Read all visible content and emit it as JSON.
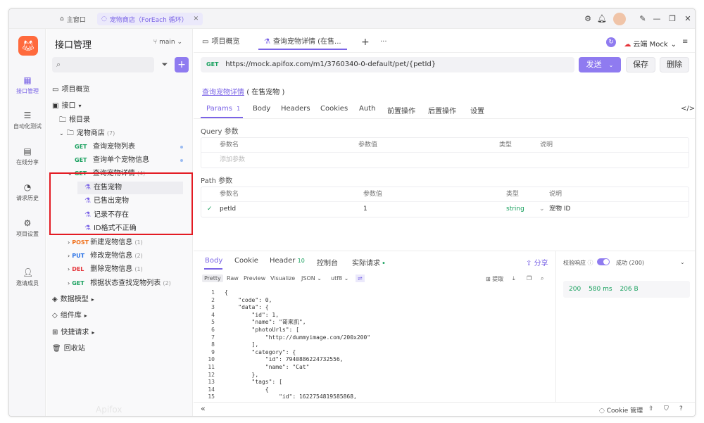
{
  "titlebar": {
    "home_label": "主窗口",
    "project_tab": "宠物商店（ForEach 循环）"
  },
  "rail": {
    "items": [
      {
        "label": "接口管理"
      },
      {
        "label": "自动化测试"
      },
      {
        "label": "在线分享"
      },
      {
        "label": "请求历史"
      },
      {
        "label": "项目设置"
      },
      {
        "label": "邀请成员"
      }
    ]
  },
  "sidebar": {
    "title": "接口管理",
    "branch": "main",
    "tree": [
      {
        "label": "项目概览"
      },
      {
        "label": "接口"
      },
      {
        "label": "根目录"
      },
      {
        "label": "宠物商店",
        "count": "(7)"
      },
      {
        "method": "GET",
        "label": "查询宠物列表"
      },
      {
        "method": "GET",
        "label": "查询单个宠物信息"
      },
      {
        "method": "GET",
        "label": "查询宠物详情",
        "count": "(4)"
      },
      {
        "label": "在售宠物"
      },
      {
        "label": "已售出宠物"
      },
      {
        "label": "记录不存在"
      },
      {
        "label": "ID格式不正确"
      },
      {
        "method": "POST",
        "label": "新建宠物信息",
        "count": "(1)"
      },
      {
        "method": "PUT",
        "label": "修改宠物信息",
        "count": "(2)"
      },
      {
        "method": "DEL",
        "label": "删除宠物信息",
        "count": "(1)"
      },
      {
        "method": "GET",
        "label": "根据状态查找宠物列表",
        "count": "(2)"
      },
      {
        "label": "数据模型"
      },
      {
        "label": "组件库"
      },
      {
        "label": "快捷请求"
      },
      {
        "label": "回收站"
      }
    ],
    "watermark": "Apifox"
  },
  "main": {
    "tabs": [
      {
        "label": "项目概览"
      },
      {
        "label": "查询宠物详情 (在售..."
      }
    ],
    "env": "云端 Mock",
    "method": "GET",
    "url": "https://mock.apifox.com/m1/3760340-0-default/pet/{petId}",
    "send": "发送",
    "save": "保存",
    "delete": "删除",
    "api_link": "查询宠物详情",
    "api_case": "( 在售宠物 )",
    "req_tabs": [
      {
        "label": "Params",
        "badge": "1"
      },
      {
        "label": "Body"
      },
      {
        "label": "Headers"
      },
      {
        "label": "Cookies"
      },
      {
        "label": "Auth"
      },
      {
        "label": "前置操作"
      },
      {
        "label": "后置操作"
      },
      {
        "label": "设置"
      }
    ],
    "query_title": "Query 参数",
    "query_headers": [
      "参数名",
      "参数值",
      "类型",
      "说明"
    ],
    "query_add": "添加参数",
    "path_title": "Path 参数",
    "path_headers": [
      "参数名",
      "参数值",
      "类型",
      "说明"
    ],
    "path_row": {
      "name": "petId",
      "value": "1",
      "type": "string",
      "desc": "宠物 ID"
    }
  },
  "response": {
    "tabs": [
      {
        "label": "Body"
      },
      {
        "label": "Cookie"
      },
      {
        "label": "Header",
        "badge": "10"
      },
      {
        "label": "控制台"
      },
      {
        "label": "实际请求"
      }
    ],
    "share": "分享",
    "formats": [
      "Pretty",
      "Raw",
      "Preview",
      "Visualize",
      "JSON",
      "utf8"
    ],
    "extract": "提取",
    "code_lines": [
      {
        "n": "1",
        "t": "{"
      },
      {
        "n": "2",
        "t": "    \"code\": 0,"
      },
      {
        "n": "3",
        "t": "    \"data\": {"
      },
      {
        "n": "4",
        "t": "        \"id\": 1,"
      },
      {
        "n": "5",
        "t": "        \"name\": \"哥来凯\","
      },
      {
        "n": "6",
        "t": "        \"photoUrls\": ["
      },
      {
        "n": "7",
        "t": "            \"http://dummyimage.com/200x200\""
      },
      {
        "n": "8",
        "t": "        ],"
      },
      {
        "n": "9",
        "t": "        \"category\": {"
      },
      {
        "n": "10",
        "t": "            \"id\": 7940886224732556,"
      },
      {
        "n": "11",
        "t": "            \"name\": \"Cat\""
      },
      {
        "n": "12",
        "t": "        },"
      },
      {
        "n": "13",
        "t": "        \"tags\": ["
      },
      {
        "n": "14",
        "t": "            {"
      },
      {
        "n": "15",
        "t": "                \"id\": 1622754819585868,"
      }
    ],
    "validate_label": "校验响应",
    "validate_value": "成功 (200)",
    "stats": {
      "status": "200",
      "time": "580 ms",
      "size": "206 B"
    }
  },
  "footer": {
    "cookie": "Cookie 管理"
  }
}
